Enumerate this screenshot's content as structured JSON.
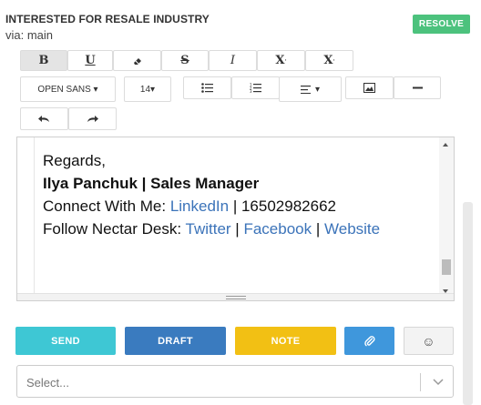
{
  "header": {
    "title": "INTERESTED FOR RESALE INDUSTRY",
    "via": "via: main",
    "resolve_label": "RESOLVE"
  },
  "toolbar": {
    "bold": "B",
    "underline": "U",
    "strike": "S",
    "italic": "I",
    "superscript": "X",
    "subscript": "X",
    "font_family": "OPEN SANS ▾",
    "font_size": "14▾",
    "align_caret": "▾"
  },
  "editor": {
    "line1": "Regards,",
    "line2": "Ilya Panchuk | Sales Manager",
    "line3_prefix": "Connect With Me: ",
    "line3_link": "LinkedIn",
    "line3_suffix": " | 16502982662",
    "line4_prefix": "Follow Nectar Desk: ",
    "line4_link1": "Twitter",
    "sep1": " | ",
    "line4_link2": "Facebook",
    "sep2": " | ",
    "line4_link3": "Website"
  },
  "actions": {
    "send": "SEND",
    "draft": "DRAFT",
    "note": "NOTE",
    "emoji": "☺"
  },
  "select": {
    "placeholder": "Select..."
  },
  "colors": {
    "resolve": "#4cc27d",
    "send": "#3ec7d4",
    "draft": "#3a7bbf",
    "note": "#f2c014",
    "attach": "#3f97dc",
    "link": "#3b73b9"
  }
}
